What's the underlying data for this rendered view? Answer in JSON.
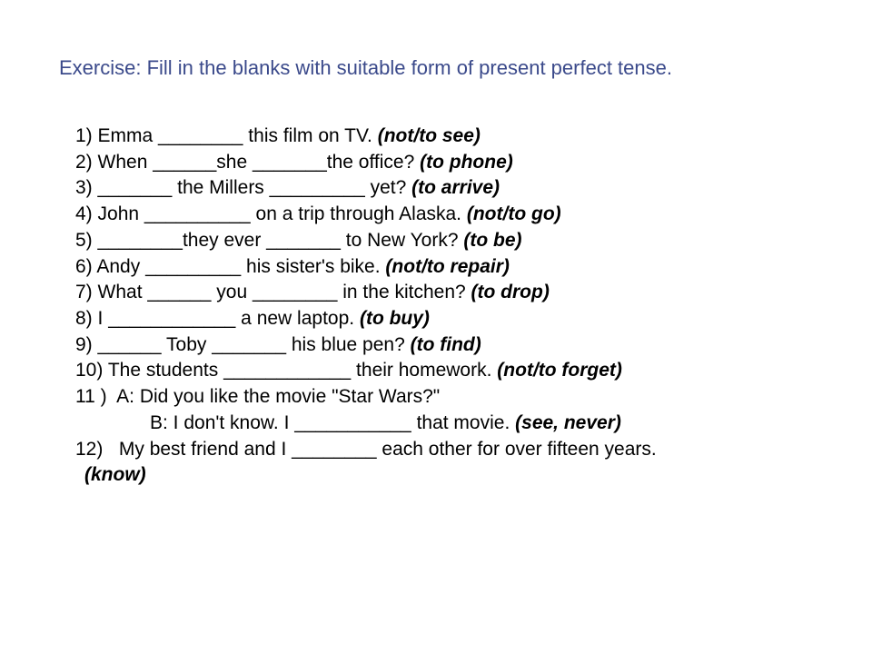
{
  "title": "Exercise: Fill in the blanks with suitable form of present perfect tense.",
  "items": {
    "q1": {
      "n": "1)",
      "text": "Emma ________ this film on TV.",
      "hint": "(not/to see)"
    },
    "q2": {
      "n": "2)",
      "text": "When ______she _______the office?",
      "hint": "(to phone)"
    },
    "q3": {
      "n": "3)",
      "text": "_______ the Millers _________ yet?",
      "hint": "(to arrive)"
    },
    "q4": {
      "n": "4)",
      "text": "John __________ on a trip through Alaska.",
      "hint": "(not/to go)"
    },
    "q5": {
      "n": "5)",
      "text": "________they ever _______ to New York?",
      "hint": "(to be)"
    },
    "q6": {
      "n": "6)",
      "text": "Andy _________ his sister's bike.",
      "hint": "(not/to repair)"
    },
    "q7": {
      "n": "7)",
      "text": "What ______ you ________ in the kitchen?",
      "hint": "(to drop)"
    },
    "q8": {
      "n": "8)",
      "text": "I ____________ a new laptop.",
      "hint": "(to buy)"
    },
    "q9": {
      "n": "9)",
      "text": "______ Toby _______ his blue pen?",
      "hint": "(to find)"
    },
    "q10": {
      "n": "10)",
      "text": "The students ____________ their homework.",
      "hint": "(not/to forget)"
    },
    "q11a": {
      "n": "11 )",
      "text": "A: Did you like the movie \"Star Wars?\""
    },
    "q11b": {
      "text": "B: I don't know. I ___________ that movie.",
      "hint": "(see, never)"
    },
    "q12": {
      "n": "12)",
      "text": "My best friend and I ________ each other for over fifteen years.",
      "hint": "(know)"
    }
  }
}
